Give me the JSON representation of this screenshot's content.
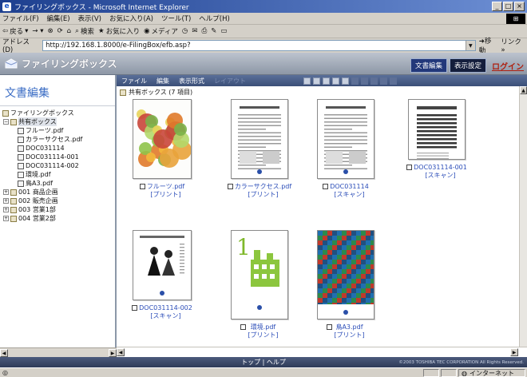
{
  "window": {
    "title": "ファイリングボックス - Microsoft Internet Explorer",
    "buttons": [
      "_",
      "□",
      "×"
    ]
  },
  "menu": {
    "items": [
      "ファイル(F)",
      "編集(E)",
      "表示(V)",
      "お気に入り(A)",
      "ツール(T)",
      "ヘルプ(H)"
    ]
  },
  "toolbar": {
    "back": "戻る",
    "search": "検索",
    "favorites": "お気に入り",
    "media": "メディア"
  },
  "address": {
    "label": "アドレス(D)",
    "url": "http://192.168.1.8000/e-FilingBox/efb.asp?",
    "go": "移動",
    "links": "リンク »"
  },
  "app": {
    "title": "ファイリングボックス",
    "btn_edit": "文書編集",
    "btn_display": "表示設定",
    "btn_login": "ログイン"
  },
  "left": {
    "page_title": "文書編集",
    "tree": [
      {
        "label": "ファイリングボックス",
        "level": 0,
        "type": "root"
      },
      {
        "label": "共有ボックス",
        "level": 0,
        "type": "box",
        "expander": "⊟",
        "selected": true
      },
      {
        "label": "フルーツ.pdf",
        "level": 1,
        "type": "doc"
      },
      {
        "label": "カラーサクセス.pdf",
        "level": 1,
        "type": "doc"
      },
      {
        "label": "DOC031114",
        "level": 1,
        "type": "doc"
      },
      {
        "label": "DOC031114-001",
        "level": 1,
        "type": "doc"
      },
      {
        "label": "DOC031114-002",
        "level": 1,
        "type": "doc"
      },
      {
        "label": "環境.pdf",
        "level": 1,
        "type": "doc"
      },
      {
        "label": "鳥A3.pdf",
        "level": 1,
        "type": "doc"
      },
      {
        "label": "001 商品企画",
        "level": 0,
        "type": "box",
        "expander": "⊞"
      },
      {
        "label": "002 販売企画",
        "level": 0,
        "type": "box",
        "expander": "⊞"
      },
      {
        "label": "003 営業1部",
        "level": 0,
        "type": "box",
        "expander": "⊞"
      },
      {
        "label": "004 営業2部",
        "level": 0,
        "type": "box",
        "expander": "⊞"
      }
    ]
  },
  "content": {
    "toolbar": {
      "file": "ファイル",
      "edit": "編集",
      "view": "表示形式",
      "layout": "レイアウト"
    },
    "folder_line": "共有ボックス (7 項目)",
    "documents": [
      {
        "name": "フルーツ.pdf",
        "type": "[プリント]",
        "thumb": "fruit"
      },
      {
        "name": "カラーサクセス.pdf",
        "type": "[プリント]",
        "thumb": "text"
      },
      {
        "name": "DOC031114",
        "type": "[スキャン]",
        "thumb": "text2"
      },
      {
        "name": "DOC031114-001",
        "type": "[スキャン]",
        "thumb": "table"
      },
      {
        "name": "DOC031114-002",
        "type": "[スキャン]",
        "thumb": "people"
      },
      {
        "name": "環境.pdf",
        "type": "[プリント]",
        "thumb": "env"
      },
      {
        "name": "鳥A3.pdf",
        "type": "[プリント]",
        "thumb": "mosaic"
      }
    ]
  },
  "footer": {
    "links": "トップ | ヘルプ",
    "copyright": "©2003 TOSHIBA TEC CORPORATION All Rights Reserved."
  },
  "status": {
    "zone": "インターネット"
  }
}
